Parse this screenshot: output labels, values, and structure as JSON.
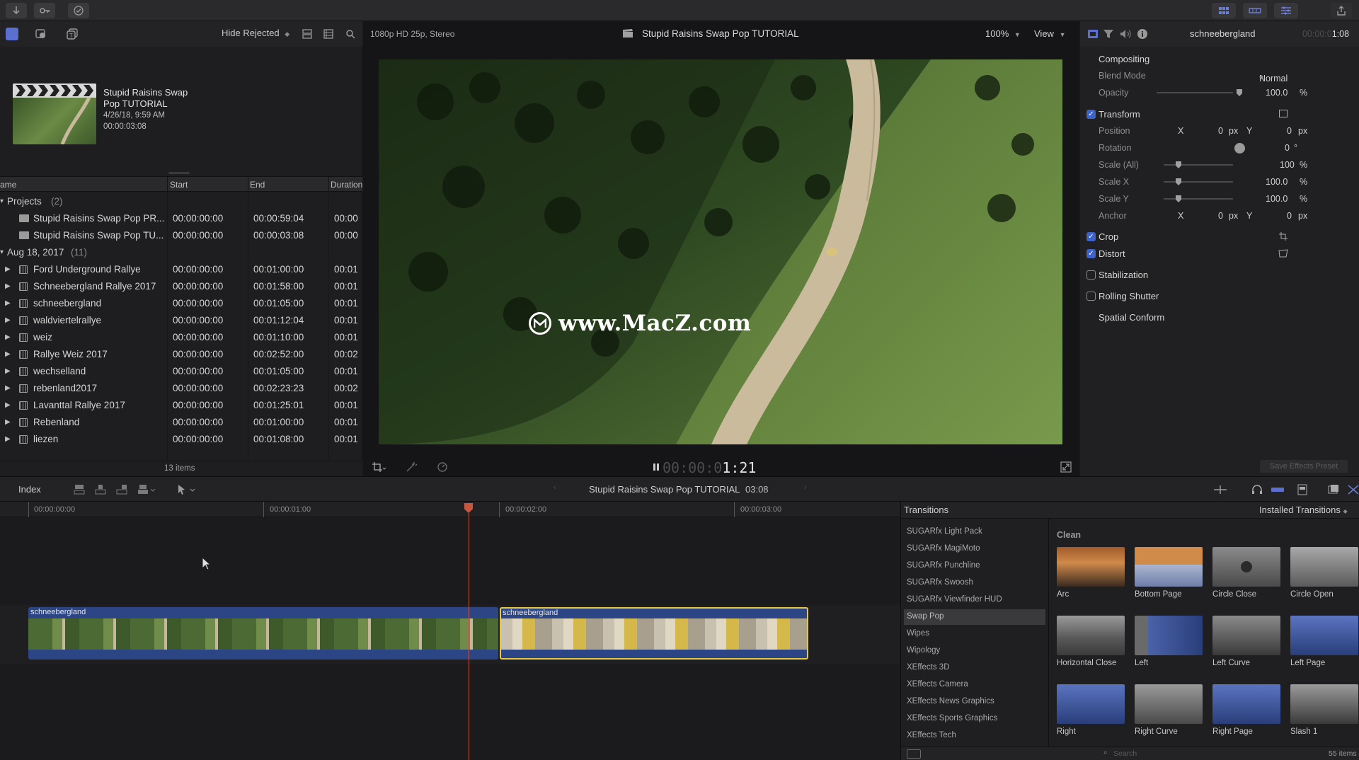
{
  "toolbar": {
    "left_icons": [
      "import-icon",
      "key-icon",
      "checkmark-icon"
    ],
    "right_icons": [
      "grid-icon",
      "timeline-icon",
      "inspector-icon",
      "share-icon"
    ]
  },
  "library": {
    "icons": [
      "libraries-icon",
      "photos-icon",
      "titles-icon"
    ],
    "filter": "Hide Rejected",
    "item": {
      "title_line1": "Stupid Raisins Swap",
      "title_line2": "Pop TUTORIAL",
      "date": "4/26/18, 9:59 AM",
      "duration": "00:00:03:08"
    },
    "columns": {
      "name": "ame",
      "start": "Start",
      "end": "End",
      "duration": "Duration"
    },
    "groups": [
      {
        "label": "Projects",
        "count": "(2)"
      },
      {
        "label": "Aug 18, 2017",
        "count": "(11)"
      }
    ],
    "projects": [
      {
        "name": "Stupid Raisins Swap Pop PR...",
        "start": "00:00:00:00",
        "end": "00:00:59:04",
        "duration": "00:00"
      },
      {
        "name": "Stupid Raisins Swap Pop TU...",
        "start": "00:00:00:00",
        "end": "00:00:03:08",
        "duration": "00:00"
      }
    ],
    "clips": [
      {
        "name": "Ford Underground Rallye",
        "start": "00:00:00:00",
        "end": "00:01:00:00",
        "duration": "00:01"
      },
      {
        "name": "Schneebergland Rallye 2017",
        "start": "00:00:00:00",
        "end": "00:01:58:00",
        "duration": "00:01"
      },
      {
        "name": "schneebergland",
        "start": "00:00:00:00",
        "end": "00:01:05:00",
        "duration": "00:01"
      },
      {
        "name": "waldviertelrallye",
        "start": "00:00:00:00",
        "end": "00:01:12:04",
        "duration": "00:01"
      },
      {
        "name": "weiz",
        "start": "00:00:00:00",
        "end": "00:01:10:00",
        "duration": "00:01"
      },
      {
        "name": "Rallye Weiz 2017",
        "start": "00:00:00:00",
        "end": "00:02:52:00",
        "duration": "00:02"
      },
      {
        "name": "wechselland",
        "start": "00:00:00:00",
        "end": "00:01:05:00",
        "duration": "00:01"
      },
      {
        "name": "rebenland2017",
        "start": "00:00:00:00",
        "end": "00:02:23:23",
        "duration": "00:02"
      },
      {
        "name": "Lavanttal Rallye 2017",
        "start": "00:00:00:00",
        "end": "00:01:25:01",
        "duration": "00:01"
      },
      {
        "name": "Rebenland",
        "start": "00:00:00:00",
        "end": "00:01:00:00",
        "duration": "00:01"
      },
      {
        "name": "liezen",
        "start": "00:00:00:00",
        "end": "00:01:08:00",
        "duration": "00:01"
      }
    ],
    "item_count": "13 items"
  },
  "viewer": {
    "format": "1080p HD 25p, Stereo",
    "title": "Stupid Raisins Swap Pop TUTORIAL",
    "zoom": "100%",
    "view_menu": "View",
    "timecode_dim": "00:00:0",
    "timecode_bright": "1:21",
    "watermark": "www.MacZ.com"
  },
  "inspector": {
    "clip_name": "schneebergland",
    "timecode_dim": "00:00:0",
    "timecode_bright": "1:08",
    "compositing": "Compositing",
    "blend_mode_label": "Blend Mode",
    "blend_mode_value": "Normal",
    "opacity_label": "Opacity",
    "opacity_value": "100.0",
    "opacity_unit": "%",
    "transform": "Transform",
    "position_label": "Position",
    "x_label": "X",
    "y_label": "Y",
    "position_x": "0",
    "position_y": "0",
    "px_unit": "px",
    "rotation_label": "Rotation",
    "rotation_value": "0",
    "degree_unit": "°",
    "scale_all_label": "Scale (All)",
    "scale_all_value": "100",
    "scale_x_label": "Scale X",
    "scale_x_value": "100.0",
    "scale_y_label": "Scale Y",
    "scale_y_value": "100.0",
    "anchor_label": "Anchor",
    "anchor_x": "0",
    "anchor_y": "0",
    "crop": "Crop",
    "distort": "Distort",
    "stabilization": "Stabilization",
    "rolling_shutter": "Rolling Shutter",
    "spatial_conform": "Spatial Conform",
    "save_preset": "Save Effects Preset"
  },
  "timeline": {
    "index_label": "Index",
    "project_title": "Stupid Raisins Swap Pop TUTORIAL",
    "project_duration": "03:08",
    "ruler": [
      "00:00:00:00",
      "00:00:01:00",
      "00:00:02:00",
      "00:00:03:00"
    ],
    "clip1_name": "schneebergland",
    "clip2_name": "schneebergland"
  },
  "transitions": {
    "header": "Transitions",
    "installed": "Installed Transitions",
    "categories": [
      "SUGARfx Light Pack",
      "SUGARfx MagiMoto",
      "SUGARfx Punchline",
      "SUGARfx Swoosh",
      "SUGARfx Viewfinder HUD",
      "Swap Pop",
      "Wipes",
      "Wipology",
      "XEffects 3D",
      "XEffects Camera",
      "XEffects News Graphics",
      "XEffects Sports Graphics",
      "XEffects Tech"
    ],
    "selected_category": "Swap Pop",
    "group_label": "Clean",
    "items": [
      "Arc",
      "Bottom Page",
      "Circle Close",
      "Circle Open",
      "Horizontal Close",
      "Left",
      "Left Curve",
      "Left Page",
      "Right",
      "Right Curve",
      "Right Page",
      "Slash 1"
    ],
    "search_placeholder": "Search",
    "count": "55 items"
  },
  "colors": {
    "accent": "#3d63c9",
    "playhead": "#c8563e",
    "selection": "#e6c845",
    "clip_blue": "#2f4a8a"
  }
}
